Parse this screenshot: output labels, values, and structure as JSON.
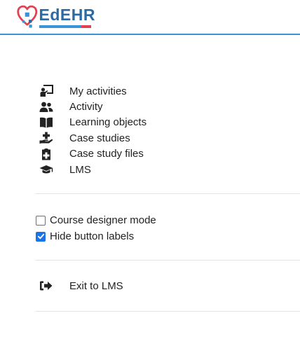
{
  "brand": {
    "name": "EdEHR",
    "colors": {
      "primary": "#2b6aa3",
      "accent": "#3a95d6",
      "heart": "#e0424f"
    }
  },
  "menu": {
    "items": [
      {
        "label": "My activities",
        "icon": "activities-board-icon"
      },
      {
        "label": "Activity",
        "icon": "users-icon"
      },
      {
        "label": "Learning objects",
        "icon": "book-open-icon"
      },
      {
        "label": "Case studies",
        "icon": "hand-plus-icon"
      },
      {
        "label": "Case study files",
        "icon": "clipboard-plus-icon"
      },
      {
        "label": "LMS",
        "icon": "graduation-cap-icon"
      }
    ]
  },
  "options": {
    "course_designer": {
      "label": "Course designer mode",
      "checked": false
    },
    "hide_labels": {
      "label": "Hide button labels",
      "checked": true
    }
  },
  "exit": {
    "label": "Exit to LMS",
    "icon": "sign-out-icon"
  }
}
